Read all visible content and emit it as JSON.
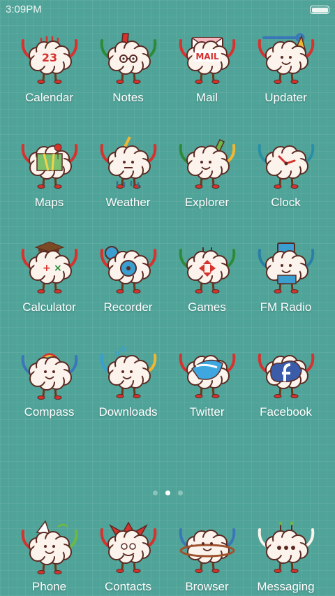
{
  "status_bar": {
    "time": "3:09PM",
    "battery_level": 1.0
  },
  "apps": [
    {
      "name": "calendar",
      "label": "Calendar",
      "icon": "calendar-icon"
    },
    {
      "name": "notes",
      "label": "Notes",
      "icon": "notes-icon"
    },
    {
      "name": "mail",
      "label": "Mail",
      "icon": "mail-icon"
    },
    {
      "name": "updater",
      "label": "Updater",
      "icon": "updater-icon"
    },
    {
      "name": "maps",
      "label": "Maps",
      "icon": "maps-icon"
    },
    {
      "name": "weather",
      "label": "Weather",
      "icon": "weather-icon"
    },
    {
      "name": "explorer",
      "label": "Explorer",
      "icon": "explorer-icon"
    },
    {
      "name": "clock",
      "label": "Clock",
      "icon": "clock-icon"
    },
    {
      "name": "calculator",
      "label": "Calculator",
      "icon": "calculator-icon"
    },
    {
      "name": "recorder",
      "label": "Recorder",
      "icon": "recorder-icon"
    },
    {
      "name": "games",
      "label": "Games",
      "icon": "games-icon"
    },
    {
      "name": "fm-radio",
      "label": "FM Radio",
      "icon": "fm-radio-icon"
    },
    {
      "name": "compass",
      "label": "Compass",
      "icon": "compass-icon"
    },
    {
      "name": "downloads",
      "label": "Downloads",
      "icon": "downloads-icon"
    },
    {
      "name": "twitter",
      "label": "Twitter",
      "icon": "twitter-icon"
    },
    {
      "name": "facebook",
      "label": "Facebook",
      "icon": "facebook-icon"
    }
  ],
  "dock": [
    {
      "name": "phone",
      "label": "Phone",
      "icon": "phone-icon"
    },
    {
      "name": "contacts",
      "label": "Contacts",
      "icon": "contacts-icon"
    },
    {
      "name": "browser",
      "label": "Browser",
      "icon": "browser-icon"
    },
    {
      "name": "messaging",
      "label": "Messaging",
      "icon": "messaging-icon"
    }
  ],
  "icon_texts": {
    "calendar_day": "23",
    "mail_word": "MAIL"
  },
  "page_indicator": {
    "count": 3,
    "active_index": 1
  },
  "colors": {
    "background": "#4fa398",
    "cloud": "#fbf3ec",
    "outline": "#5a2a22",
    "red": "#d6322e",
    "twitter_blue": "#3fa7e0",
    "facebook_blue": "#3b5ca8"
  }
}
